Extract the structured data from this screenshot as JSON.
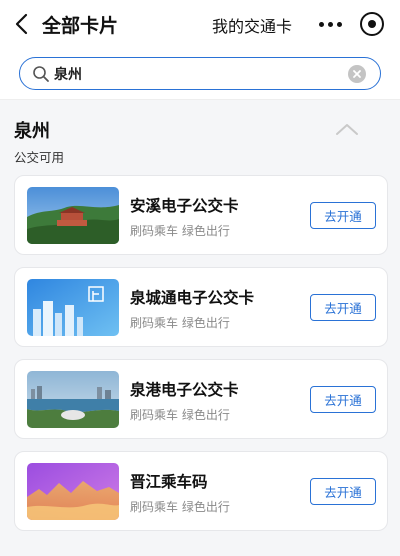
{
  "header": {
    "title": "全部卡片",
    "my_card_link": "我的交通卡"
  },
  "search": {
    "value": "泉州",
    "accent_color": "#2a72d6"
  },
  "section": {
    "title": "泉州",
    "subtitle": "公交可用"
  },
  "cards": [
    {
      "name": "安溪电子公交卡",
      "desc": "刷码乘车 绿色出行",
      "button": "去开通"
    },
    {
      "name": "泉城通电子公交卡",
      "desc": "刷码乘车 绿色出行",
      "button": "去开通"
    },
    {
      "name": "泉港电子公交卡",
      "desc": "刷码乘车 绿色出行",
      "button": "去开通"
    },
    {
      "name": "晋江乘车码",
      "desc": "刷码乘车 绿色出行",
      "button": "去开通"
    }
  ],
  "icons": [
    "back-arrow-icon",
    "more-dots-icon",
    "close-target-icon",
    "search-icon",
    "clear-icon",
    "chevron-up-icon"
  ]
}
